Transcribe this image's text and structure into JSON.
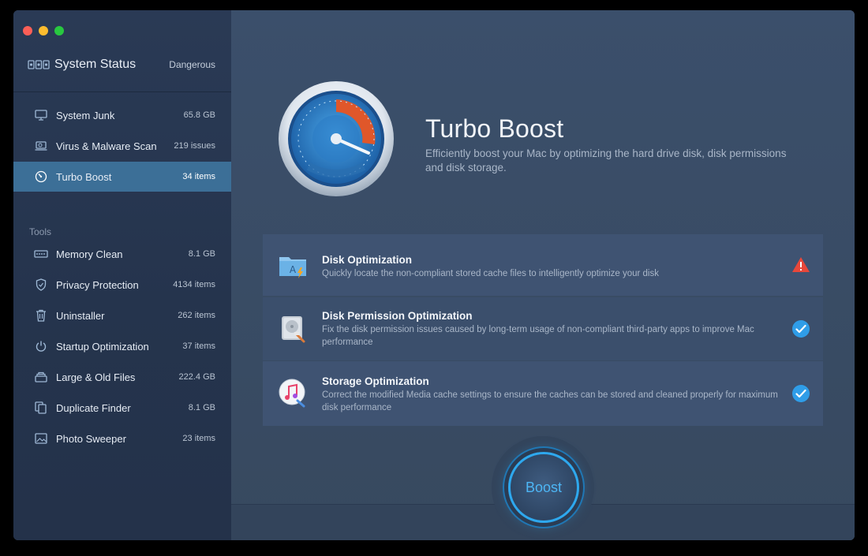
{
  "sidebar": {
    "status": {
      "title": "System Status",
      "value": "Dangerous"
    },
    "scan_items": [
      {
        "label": "System Junk",
        "value": "65.8 GB",
        "icon": "monitor-icon"
      },
      {
        "label": "Virus & Malware Scan",
        "value": "219 issues",
        "icon": "laptop-scan-icon"
      },
      {
        "label": "Turbo Boost",
        "value": "34 items",
        "icon": "speedometer-icon",
        "active": true
      }
    ],
    "tools_label": "Tools",
    "tools": [
      {
        "label": "Memory Clean",
        "value": "8.1 GB",
        "icon": "memory-chip-icon"
      },
      {
        "label": "Privacy Protection",
        "value": "4134 items",
        "icon": "shield-icon"
      },
      {
        "label": "Uninstaller",
        "value": "262 items",
        "icon": "trash-icon"
      },
      {
        "label": "Startup Optimization",
        "value": "37 items",
        "icon": "power-icon"
      },
      {
        "label": "Large & Old Files",
        "value": "222.4 GB",
        "icon": "file-stack-icon"
      },
      {
        "label": "Duplicate Finder",
        "value": "8.1 GB",
        "icon": "duplicate-icon"
      },
      {
        "label": "Photo Sweeper",
        "value": "23 items",
        "icon": "photo-icon"
      }
    ]
  },
  "hero": {
    "title": "Turbo Boost",
    "description": "Efficiently boost your Mac by optimizing the hard drive disk, disk permissions and disk storage."
  },
  "cards": [
    {
      "title": "Disk Optimization",
      "description": "Quickly locate the non-compliant stored cache files to intelligently optimize your disk",
      "status": "warning",
      "icon": "app-folder-icon"
    },
    {
      "title": "Disk Permission Optimization",
      "description": "Fix the disk permission issues caused by long-term usage of non-compliant third-party apps to improve Mac performance",
      "status": "ok",
      "icon": "disk-utility-icon"
    },
    {
      "title": "Storage Optimization",
      "description": "Correct the modified Media cache settings to ensure the caches can be stored and cleaned properly for maximum disk performance",
      "status": "ok",
      "icon": "music-note-icon"
    }
  ],
  "boost_button": "Boost",
  "colors": {
    "accent": "#2ea8ee",
    "active_item": "#3c6f97",
    "warning": "#e8473a",
    "ok": "#2f9de8"
  }
}
